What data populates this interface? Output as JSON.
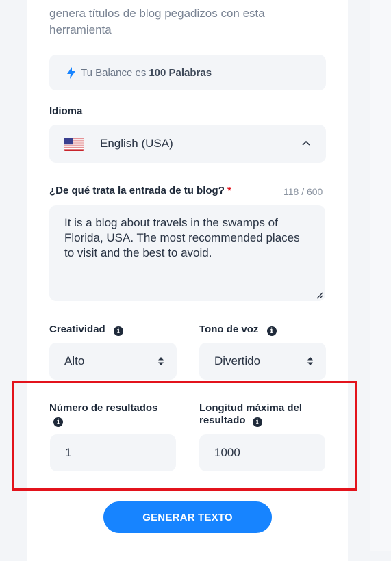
{
  "intro": {
    "line0": "...",
    "line1": "genera títulos de blog pegadizos con esta",
    "line2": "herramienta"
  },
  "balance": {
    "prefix": "Tu Balance es",
    "value": "100 Palabras",
    "icon": "bolt-icon"
  },
  "language": {
    "label": "Idioma",
    "selected": "English (USA)",
    "flag": "us-flag-icon"
  },
  "topic": {
    "label": "¿De qué trata la entrada de tu blog?",
    "required_mark": "*",
    "counter": "118 / 600",
    "value": "It is a blog about travels in the swamps of Florida, USA. The most recommended places to visit and the best to avoid."
  },
  "creativity": {
    "label": "Creatividad",
    "value": "Alto"
  },
  "tone": {
    "label": "Tono de voz",
    "value": "Divertido"
  },
  "results": {
    "label": "Número de resultados",
    "value": "1"
  },
  "max_length": {
    "label": "Longitud máxima del resultado",
    "value": "1000"
  },
  "submit": {
    "label": "GENERAR TEXTO"
  },
  "colors": {
    "accent": "#1784ff",
    "highlight": "#e3131c"
  }
}
